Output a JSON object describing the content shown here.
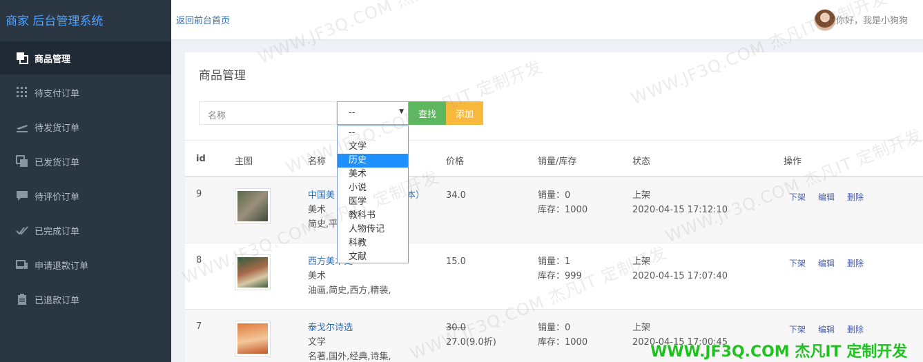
{
  "brand": "商家 后台管理系统",
  "nav": [
    {
      "label": "商品管理",
      "icon": "copy-icon",
      "active": true
    },
    {
      "label": "待支付订单",
      "icon": "grid-dots-icon",
      "active": false
    },
    {
      "label": "待发货订单",
      "icon": "plane-icon",
      "active": false
    },
    {
      "label": "已发货订单",
      "icon": "copy-icon",
      "active": false
    },
    {
      "label": "待评价订单",
      "icon": "comment-icon",
      "active": false
    },
    {
      "label": "已完成订单",
      "icon": "double-check-icon",
      "active": false
    },
    {
      "label": "申请退款订单",
      "icon": "devices-icon",
      "active": false
    },
    {
      "label": "已退款订单",
      "icon": "clipboard-icon",
      "active": false
    }
  ],
  "topbar": {
    "back_link": "返回前台首页",
    "greeting": "你好，我是小狗狗"
  },
  "panel": {
    "title": "商品管理",
    "search_placeholder": "名称",
    "select_value": "--",
    "find_label": "查找",
    "add_label": "添加"
  },
  "dropdown_options": [
    "--",
    "文学",
    "历史",
    "美术",
    "小说",
    "医学",
    "教科书",
    "人物传记",
    "科教",
    "文献"
  ],
  "dropdown_selected_index": 2,
  "table": {
    "headers": [
      "id",
      "主图",
      "名称",
      "价格",
      "销量/库存",
      "状态",
      "操作"
    ],
    "rows": [
      {
        "id": "9",
        "name": "中国美",
        "name_suffix": "本）",
        "category": "美术",
        "tags": "简史,平",
        "price": "34.0",
        "price_old": "",
        "sales": "销量：0",
        "stock": "库存：1000",
        "status": "上架",
        "time": "2020-04-15 17:12:10",
        "ops": [
          "下架",
          "编辑",
          "删除"
        ]
      },
      {
        "id": "8",
        "name": "西方美术史",
        "name_suffix": "",
        "category": "美术",
        "tags": "油画,简史,西方,精装,",
        "price": "15.0",
        "price_old": "",
        "sales": "销量：1",
        "stock": "库存：999",
        "status": "上架",
        "time": "2020-04-15 17:07:40",
        "ops": [
          "下架",
          "编辑",
          "删除"
        ]
      },
      {
        "id": "7",
        "name": "泰戈尔诗选",
        "name_suffix": "",
        "category": "文学",
        "tags": "名著,国外,经典,诗集,",
        "price": "27.0(9.0折)",
        "price_old": "30.0",
        "sales": "销量：0",
        "stock": "库存：1000",
        "status": "上架",
        "time": "2020-04-15 17:00:45",
        "ops": [
          "下架",
          "编辑",
          "删除"
        ]
      }
    ]
  },
  "watermark": "WWW.JF3Q.COM 杰凡IT 定制开发",
  "colors": {
    "sidebar": "#2b3643",
    "brand": "#4fa3ff",
    "find_button": "#5cb85c",
    "add_button": "#f7b93b",
    "link": "#2f6fb4",
    "corner_watermark": "#1fc21f"
  }
}
